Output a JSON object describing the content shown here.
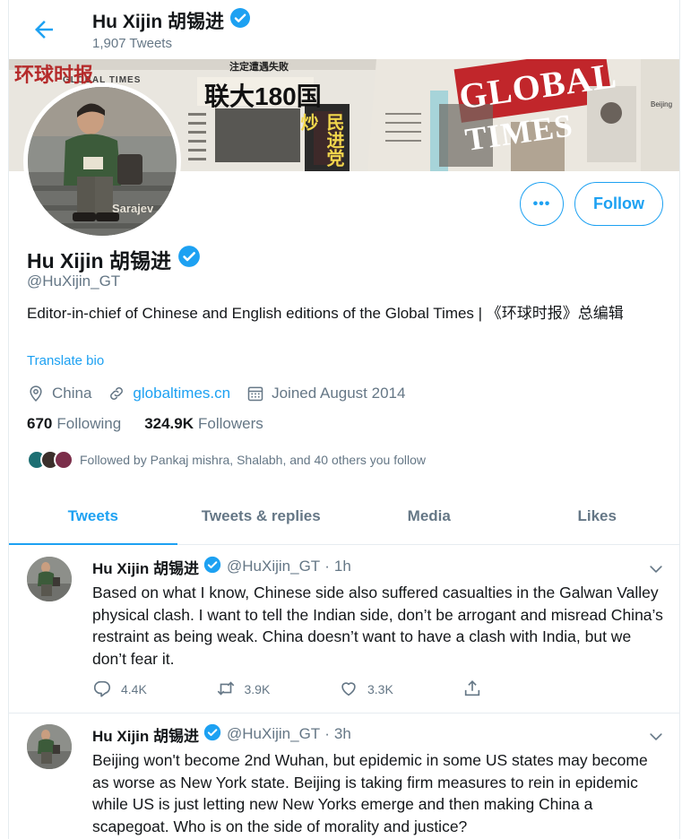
{
  "header": {
    "name": "Hu Xijin 胡锡进",
    "tweet_count": "1,907 Tweets"
  },
  "banner": {
    "texts": [
      "GLOBAL TIMES",
      "环球时报",
      "联大180国",
      "民进党炒",
      "注定遭遇失败",
      "Beijing"
    ]
  },
  "avatar": {
    "caption": "Sarajev"
  },
  "profile": {
    "more_label": "•••",
    "follow_label": "Follow",
    "name": "Hu Xijin 胡锡进",
    "handle": "@HuXijin_GT",
    "bio": "Editor-in-chief of Chinese and English editions of the Global Times | 《环球时报》总编辑",
    "translate": "Translate bio",
    "location": "China",
    "website": "globaltimes.cn",
    "joined": "Joined August 2014",
    "following_count": "670",
    "following_label": "Following",
    "followers_count": "324.9K",
    "followers_label": "Followers",
    "followed_by": "Followed by Pankaj mishra, Shalabh, and 40 others you follow"
  },
  "tabs": [
    "Tweets",
    "Tweets & replies",
    "Media",
    "Likes"
  ],
  "tweets": [
    {
      "name": "Hu Xijin 胡锡进",
      "handle": "@HuXijin_GT",
      "dot": "·",
      "time": "1h",
      "text": "Based on what I know, Chinese side also suffered casualties in the Galwan Valley physical clash. I want to tell the Indian side, don’t be arrogant and misread China’s restraint as being weak. China doesn’t want to have a clash with India, but we don’t fear it.",
      "replies": "4.4K",
      "retweets": "3.9K",
      "likes": "3.3K"
    },
    {
      "name": "Hu Xijin 胡锡进",
      "handle": "@HuXijin_GT",
      "dot": "·",
      "time": "3h",
      "text": "Beijing won't become 2nd Wuhan, but epidemic in some US states may become as worse as New York state. Beijing is taking firm measures to rein in epidemic while US is just letting new New Yorks emerge and then making China a scapegoat. Who is on the side of morality and justice?"
    }
  ],
  "colors": {
    "accent": "#1da1f2",
    "text": "#14171a",
    "muted": "#657786",
    "border": "#e6ecf0"
  }
}
